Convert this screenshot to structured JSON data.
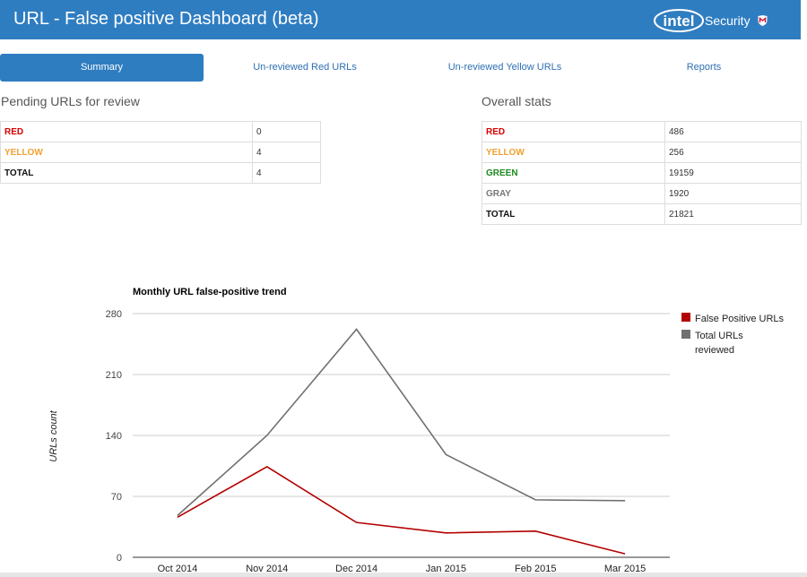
{
  "header": {
    "title": "URL - False positive Dashboard (beta)",
    "brand_logo": "intel",
    "brand_text": "Security"
  },
  "nav": {
    "tabs": [
      {
        "label": "Summary",
        "active": true
      },
      {
        "label": "Un-reviewed Red URLs",
        "active": false
      },
      {
        "label": "Un-reviewed Yellow URLs",
        "active": false
      },
      {
        "label": "Reports",
        "active": false
      }
    ]
  },
  "pending": {
    "title": "Pending URLs for review",
    "rows": [
      {
        "label": "RED",
        "value": "0"
      },
      {
        "label": "YELLOW",
        "value": "4"
      },
      {
        "label": "TOTAL",
        "value": "4"
      }
    ]
  },
  "overall": {
    "title": "Overall stats",
    "rows": [
      {
        "label": "RED",
        "value": "486"
      },
      {
        "label": "YELLOW",
        "value": "256"
      },
      {
        "label": "GREEN",
        "value": "19159"
      },
      {
        "label": "GRAY",
        "value": "1920"
      },
      {
        "label": "TOTAL",
        "value": "21821"
      }
    ]
  },
  "colors": {
    "header": "#2f7dc1",
    "red": "#d40000",
    "yellow": "#f0a030",
    "green": "#1c8a1c",
    "gray": "#777777",
    "series_fp": "#b30000",
    "series_total": "#707070"
  },
  "chart_data": {
    "type": "line",
    "title": "Monthly URL false-positive trend",
    "ylabel": "URLs count",
    "xlabel": "",
    "categories": [
      "Oct 2014",
      "Nov 2014",
      "Dec 2014",
      "Jan 2015",
      "Feb 2015",
      "Mar 2015"
    ],
    "series": [
      {
        "name": "False Positive URLs",
        "values": [
          46,
          104,
          40,
          28,
          30,
          4
        ]
      },
      {
        "name": "Total URLs reviewed",
        "values": [
          48,
          140,
          262,
          118,
          66,
          65
        ]
      }
    ],
    "ylim": [
      0,
      280
    ],
    "yticks": [
      "0",
      "70",
      "140",
      "210",
      "280"
    ],
    "grid": true,
    "legend": "right"
  }
}
